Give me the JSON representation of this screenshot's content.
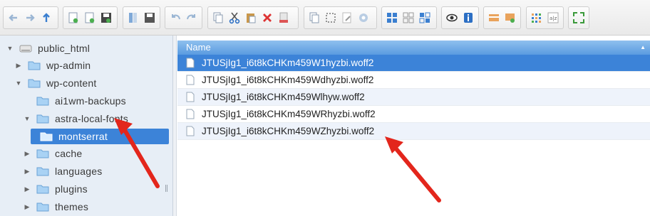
{
  "toolbar": {
    "icons": [
      "back-icon",
      "forward-icon",
      "up-icon",
      "new-file-icon",
      "new-folder-icon",
      "save-icon",
      "view-icon",
      "save-as-icon",
      "undo-icon",
      "redo-icon",
      "copy-icon",
      "cut-icon",
      "paste-icon",
      "delete-icon",
      "empty-icon",
      "duplicate-icon",
      "select-icon",
      "rename-icon",
      "settings-icon",
      "icons-view-icon",
      "list-view-icon",
      "grid-view-icon",
      "preview-icon",
      "info-icon",
      "extract-icon",
      "archive-icon",
      "sort-icon",
      "resize-icon",
      "fullscreen-icon"
    ]
  },
  "tree": {
    "root": "public_html",
    "items": [
      {
        "label": "wp-admin"
      },
      {
        "label": "wp-content"
      },
      {
        "label": "ai1wm-backups"
      },
      {
        "label": "astra-local-fonts"
      },
      {
        "label": "montserrat"
      },
      {
        "label": "cache"
      },
      {
        "label": "languages"
      },
      {
        "label": "plugins"
      },
      {
        "label": "themes"
      }
    ]
  },
  "files": {
    "column_header": "Name",
    "rows": [
      "JTUSjIg1_i6t8kCHKm459W1hyzbi.woff2",
      "JTUSjIg1_i6t8kCHKm459Wdhyzbi.woff2",
      "JTUSjIg1_i6t8kCHKm459Wlhyw.woff2",
      "JTUSjIg1_i6t8kCHKm459WRhyzbi.woff2",
      "JTUSjIg1_i6t8kCHKm459WZhyzbi.woff2"
    ]
  },
  "colors": {
    "selection": "#3c83d8",
    "folder": "#9fcdf3",
    "annotation_arrow": "#e3261c"
  }
}
